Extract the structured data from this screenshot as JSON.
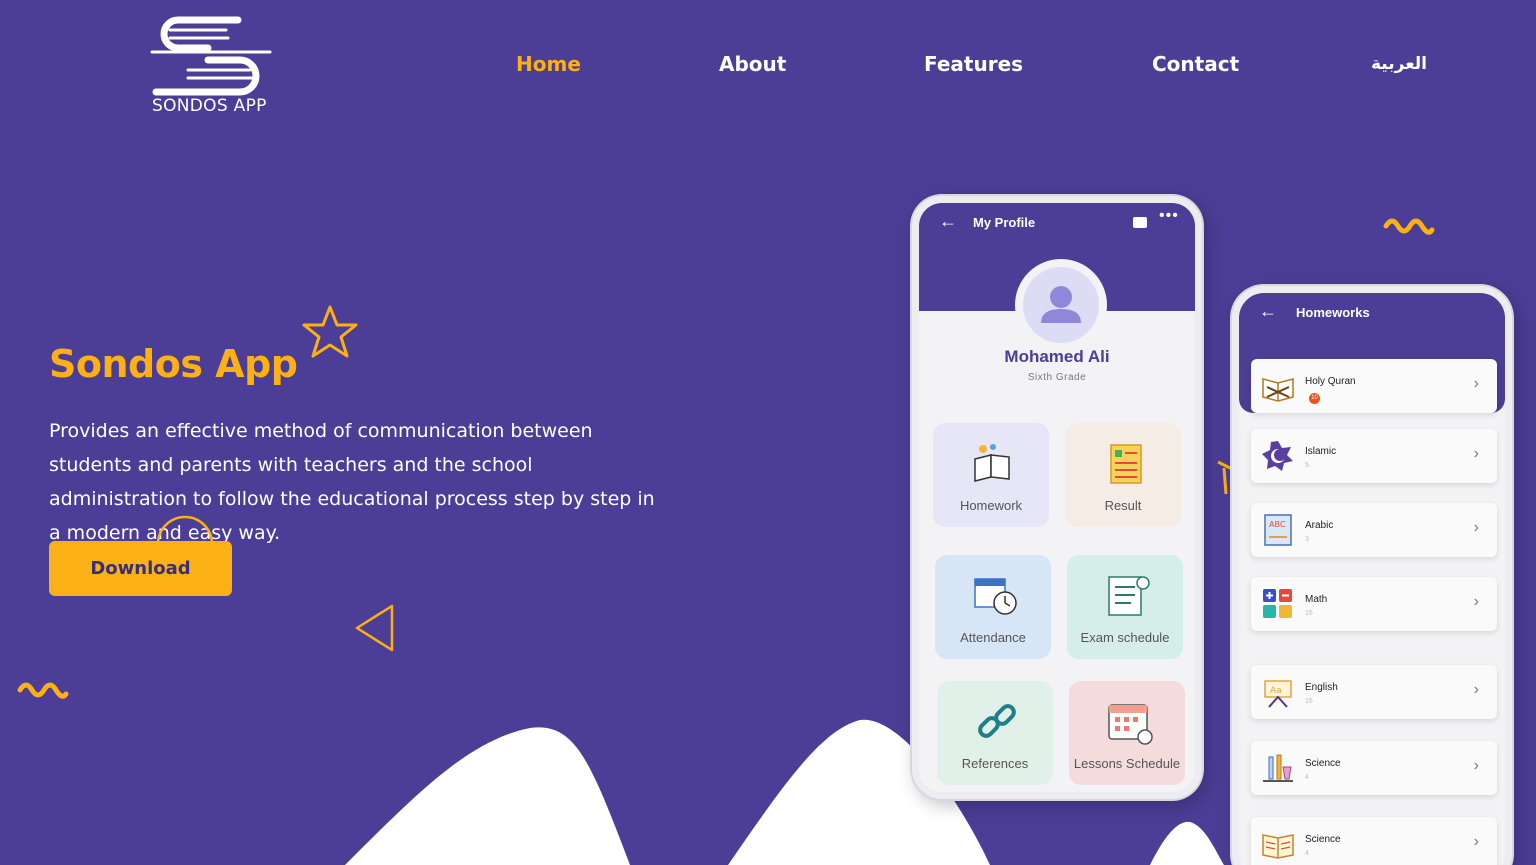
{
  "header": {
    "logo_text": "SONDOS APP",
    "nav": [
      {
        "label": "Home",
        "active": true
      },
      {
        "label": "About",
        "active": false
      },
      {
        "label": "Features",
        "active": false
      },
      {
        "label": "Contact",
        "active": false
      },
      {
        "label": "العربية",
        "active": false
      }
    ]
  },
  "hero": {
    "title": "Sondos App",
    "description": "Provides an effective method of communication between students and parents with teachers and the school administration to follow the educational process step by step in a modern and easy way.",
    "download_label": "Download"
  },
  "profile_screen": {
    "title": "My Profile",
    "name": "Mohamed Ali",
    "grade": "Sixth Grade",
    "tiles": [
      {
        "label": "Homework",
        "icon": "books-icon"
      },
      {
        "label": "Result",
        "icon": "report-icon"
      },
      {
        "label": "Attendance",
        "icon": "calendar-clock-icon"
      },
      {
        "label": "Exam schedule",
        "icon": "checklist-icon"
      },
      {
        "label": "References",
        "icon": "link-icon"
      },
      {
        "label": "Lessons Schedule",
        "icon": "calendar-icon"
      }
    ]
  },
  "homeworks_screen": {
    "title": "Homeworks",
    "items": [
      {
        "subject": "Holy Quran",
        "count": "10",
        "icon": "quran-icon"
      },
      {
        "subject": "Islamic",
        "count": "5",
        "icon": "crescent-icon"
      },
      {
        "subject": "Arabic",
        "count": "3",
        "icon": "abc-book-icon"
      },
      {
        "subject": "Math",
        "count": "15",
        "icon": "math-icon"
      },
      {
        "subject": "English",
        "count": "15",
        "icon": "easel-icon"
      },
      {
        "subject": "Science",
        "count": "4",
        "icon": "lab-icon"
      },
      {
        "subject": "Science",
        "count": "4",
        "icon": "open-book-icon"
      }
    ]
  },
  "colors": {
    "background": "#4c3d96",
    "accent": "#fbb116"
  }
}
